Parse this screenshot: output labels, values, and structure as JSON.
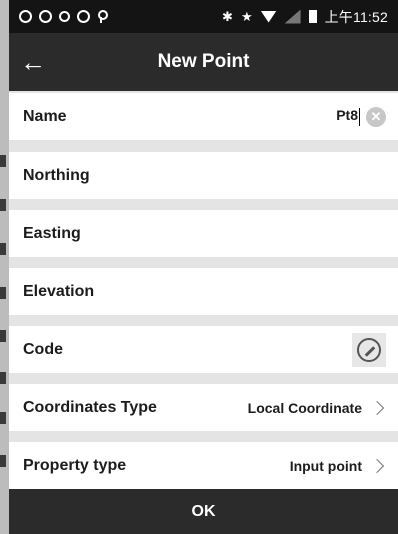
{
  "status_bar": {
    "time": "上午11:52",
    "left_icons": [
      "sync-icon",
      "sync-icon",
      "circle-icon",
      "sync-icon",
      "location-pin-icon"
    ],
    "right_icons": [
      "bluetooth-icon",
      "star-icon",
      "wifi-icon",
      "signal-icon",
      "battery-icon"
    ]
  },
  "app_bar": {
    "title": "New Point",
    "back_icon": "←"
  },
  "form": {
    "name": {
      "label": "Name",
      "value": "Pt8"
    },
    "northing": {
      "label": "Northing",
      "value": ""
    },
    "easting": {
      "label": "Easting",
      "value": ""
    },
    "elevation": {
      "label": "Elevation",
      "value": ""
    },
    "code": {
      "label": "Code",
      "value": ""
    },
    "coordinates_type": {
      "label": "Coordinates Type",
      "value": "Local Coordinate"
    },
    "property_type": {
      "label": "Property type",
      "value": "Input point"
    }
  },
  "ok_button": {
    "label": "OK"
  },
  "colors": {
    "bar": "#2b2b2b",
    "statusbar": "#141414",
    "divider": "#e4e4e4",
    "row": "#ffffff"
  }
}
